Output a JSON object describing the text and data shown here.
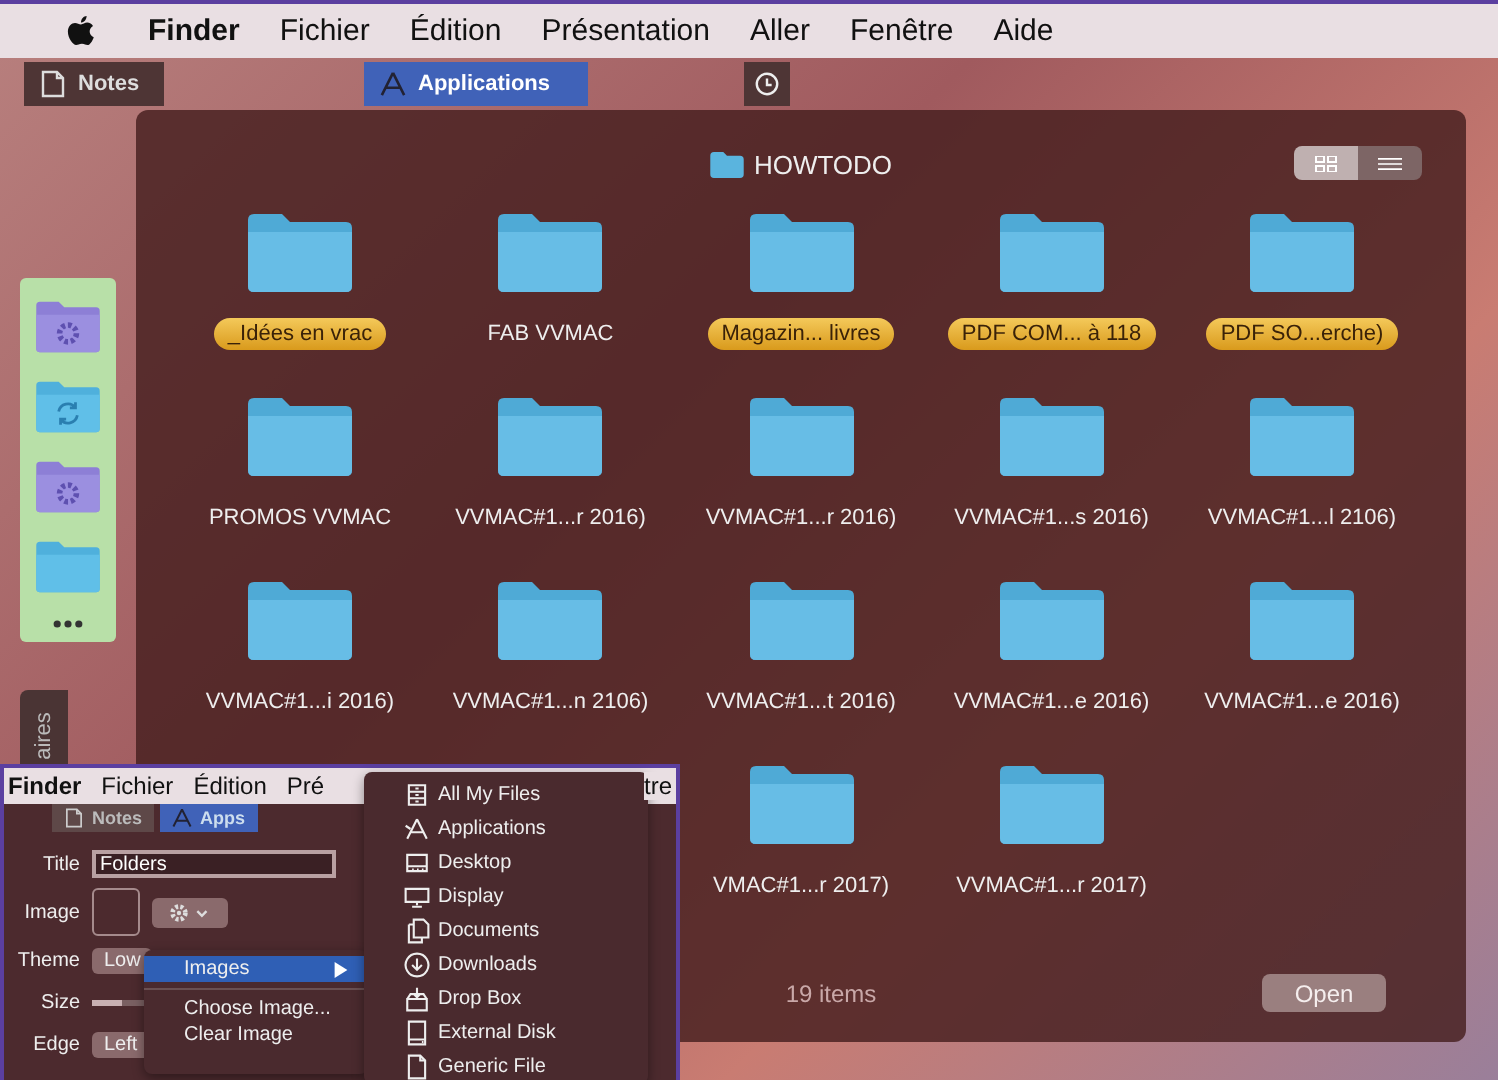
{
  "menu_bar": {
    "app_name": "Finder",
    "menus": [
      "Fichier",
      "Édition",
      "Présentation",
      "Aller",
      "Fenêtre",
      "Aide"
    ]
  },
  "stack_tabs": [
    {
      "kind": "document",
      "label": "Notes",
      "selected": false
    },
    {
      "kind": "apps",
      "label": "Applications",
      "selected": true
    },
    {
      "kind": "clock",
      "selected": false
    }
  ],
  "dock_stack": {
    "folders": [
      {
        "kind": "gear"
      },
      {
        "kind": "sync"
      },
      {
        "kind": "gear"
      },
      {
        "kind": "plain"
      }
    ]
  },
  "side_tab": {
    "label": "aires"
  },
  "stack_window": {
    "title": "HOWTODO",
    "view_modes": [
      {
        "kind": "grid",
        "selected": true
      },
      {
        "kind": "list",
        "selected": false
      }
    ],
    "items": [
      {
        "name": "_Idées en vrac",
        "tagged": true
      },
      {
        "name": "FAB VVMAC",
        "tagged": false
      },
      {
        "name": "Magazin... livres",
        "tagged": true
      },
      {
        "name": "PDF COM... à 118",
        "tagged": true
      },
      {
        "name": "PDF SO...erche)",
        "tagged": true
      },
      {
        "name": "PROMOS VVMAC",
        "tagged": false
      },
      {
        "name": "VVMAC#1...r 2016)",
        "tagged": false
      },
      {
        "name": "VVMAC#1...r 2016)",
        "tagged": false
      },
      {
        "name": "VVMAC#1...s 2016)",
        "tagged": false
      },
      {
        "name": "VVMAC#1...l 2106)",
        "tagged": false
      },
      {
        "name": "VVMAC#1...i 2016)",
        "tagged": false
      },
      {
        "name": "VVMAC#1...n 2106)",
        "tagged": false
      },
      {
        "name": "VVMAC#1...t 2016)",
        "tagged": false
      },
      {
        "name": "VVMAC#1...e 2016)",
        "tagged": false
      },
      {
        "name": "VVMAC#1...e 2016)",
        "tagged": false
      },
      {
        "name": "VMAC#1...r 2017)",
        "tagged": false
      },
      {
        "name": "VVMAC#1...r 2017)",
        "tagged": false
      }
    ],
    "count": "19 items",
    "open_button": "Open"
  },
  "inset": {
    "menu_bar": {
      "app_name": "Finder",
      "menus": [
        "Fichier",
        "Édition",
        "Pré"
      ],
      "trailing": "tre"
    },
    "tabs": [
      {
        "kind": "document",
        "label": "Notes",
        "selected": false
      },
      {
        "kind": "apps",
        "label": "Apps",
        "selected": true
      }
    ],
    "form": {
      "title_label": "Title",
      "title_value": "Folders",
      "image_label": "Image",
      "theme_label": "Theme",
      "theme_option": "Low",
      "size_label": "Size",
      "size_slider": {
        "level": 0.5
      },
      "edge_label": "Edge",
      "edge_option": "Left"
    },
    "context_menu": [
      {
        "kind": "item",
        "label": "Images",
        "submenu": true,
        "selected": true
      },
      {
        "kind": "separator"
      },
      {
        "kind": "item",
        "label": "Choose Image...",
        "submenu": false,
        "selected": false
      },
      {
        "kind": "item",
        "label": "Clear Image",
        "submenu": false,
        "selected": false
      }
    ],
    "submenu": [
      {
        "kind": "files",
        "label": "All My Files"
      },
      {
        "kind": "apps",
        "label": "Applications"
      },
      {
        "kind": "desktop",
        "label": "Desktop"
      },
      {
        "kind": "display",
        "label": "Display"
      },
      {
        "kind": "documents",
        "label": "Documents"
      },
      {
        "kind": "downloads",
        "label": "Downloads"
      },
      {
        "kind": "dropbox",
        "label": "Drop Box"
      },
      {
        "kind": "disk",
        "label": "External Disk"
      },
      {
        "kind": "file",
        "label": "Generic File"
      }
    ]
  }
}
